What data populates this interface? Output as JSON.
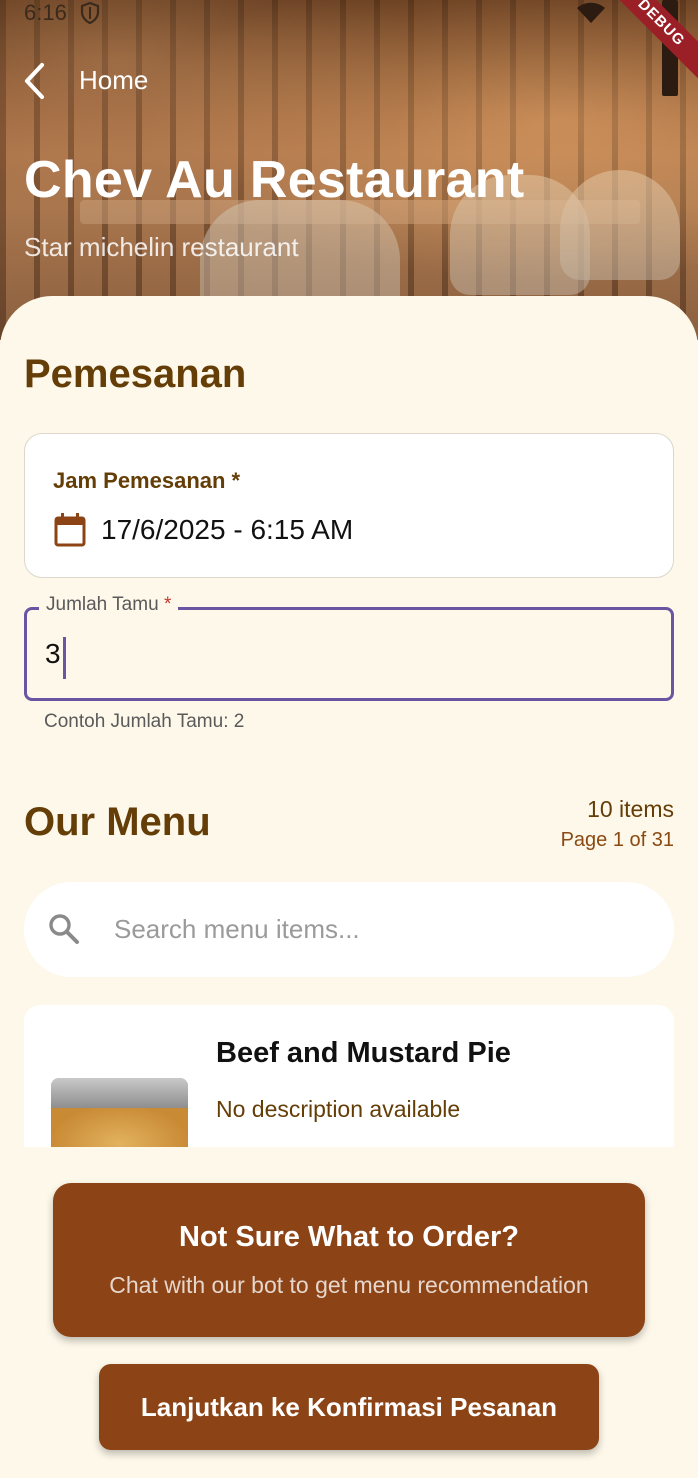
{
  "status_bar": {
    "time": "6:16"
  },
  "debug_banner": "DEBUG",
  "app_bar": {
    "back_label": "Home"
  },
  "hero": {
    "title": "Chev Au Restaurant",
    "subtitle": "Star michelin restaurant"
  },
  "booking": {
    "section_title": "Pemesanan",
    "date_label": "Jam Pemesanan *",
    "date_value": "17/6/2025 - 6:15 AM",
    "guest_label": "Jumlah Tamu",
    "guest_required_mark": "*",
    "guest_value": "3",
    "guest_helper": "Contoh Jumlah Tamu: 2"
  },
  "menu": {
    "section_title": "Our Menu",
    "item_count": "10 items",
    "page_info": "Page 1 of 31",
    "search_placeholder": "Search menu items...",
    "items": [
      {
        "name": "Beef and Mustard Pie",
        "description": "No description available"
      }
    ]
  },
  "chat_prompt": {
    "title": "Not Sure What to Order?",
    "subtitle": "Chat with our bot to get menu recommendation"
  },
  "actions": {
    "confirm_label": "Lanjutkan ke Konfirmasi Pesanan"
  },
  "colors": {
    "brand_brown": "#8c4416",
    "heading_brown": "#643d07",
    "background_cream": "#fdf8ea",
    "focus_purple": "#6b55a3",
    "required_red": "#c0392b"
  },
  "icons": [
    "shield-icon",
    "wifi-icon",
    "back-arrow-icon",
    "calendar-icon",
    "search-icon"
  ]
}
